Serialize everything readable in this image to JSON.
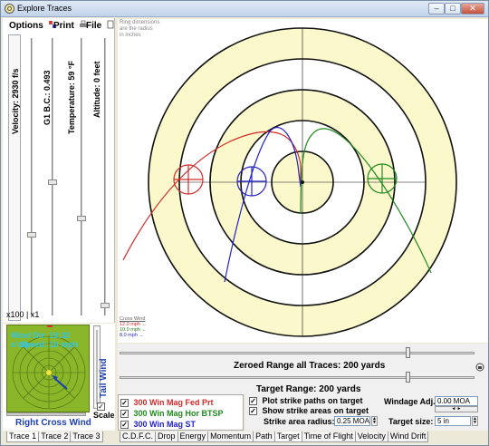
{
  "window": {
    "title": "Explore Traces"
  },
  "menu": {
    "options": "Options",
    "print": "Print",
    "file": "File"
  },
  "params": {
    "velocity": "Velocity:  2930 f/s",
    "bc": "G1 B.C.:  0.493",
    "temperature": "Temperature:  59 °F",
    "altitude": "Altitude:  0 feet"
  },
  "zoom": "x100 | x1",
  "wind": {
    "dir_line": "Wind Dir: 10:32 o'clk",
    "speed_line": "Speed: 10 mph",
    "tail": "Tail Wind",
    "cross": "Right Cross Wind",
    "scale": "Scale"
  },
  "target": {
    "note_line1": "Ring dimensions",
    "note_line2": "are the radius",
    "note_line3": "in inches",
    "legend_title": "Cross Wind",
    "legend_items": [
      {
        "text": "12.0 mph ←",
        "color": "#d42a2a"
      },
      {
        "text": "10.0 mph ←",
        "color": "#2a7a2a"
      },
      {
        "text": "8.0 mph ←",
        "color": "#2a2ad4"
      }
    ],
    "ring_fill": "#fbf8cc"
  },
  "range": {
    "zeroed": "Zeroed Range all Traces:  200 yards",
    "target_range": "Target Range:  200 yards"
  },
  "loads": [
    {
      "name": "300 Win Mag Fed Prt",
      "color": "#d42a2a",
      "checked": "✓"
    },
    {
      "name": "300 Win Mag Hor BTSP",
      "color": "#1f8a1f",
      "checked": "✓"
    },
    {
      "name": "300 Win Mag ST",
      "color": "#2323c8",
      "checked": "✓"
    }
  ],
  "options": {
    "plot_paths": "Plot strike paths on target",
    "show_areas": "Show strike areas on target",
    "strike_radius_label": "Strike area radius:",
    "strike_radius_value": "0.25 MOA",
    "windage_label": "Windage Adj.:",
    "windage_value": "0.00 MOA",
    "target_size_label": "Target size:",
    "target_size_value": "5 in",
    "check": "✓"
  },
  "left_tabs": [
    "Trace 1",
    "Trace 2",
    "Trace 3"
  ],
  "bottom_tabs": [
    "C.D.F.C.",
    "Drop",
    "Energy",
    "Momentum",
    "Path",
    "Target",
    "Time of Flight",
    "Velocity",
    "Wind Drift"
  ]
}
